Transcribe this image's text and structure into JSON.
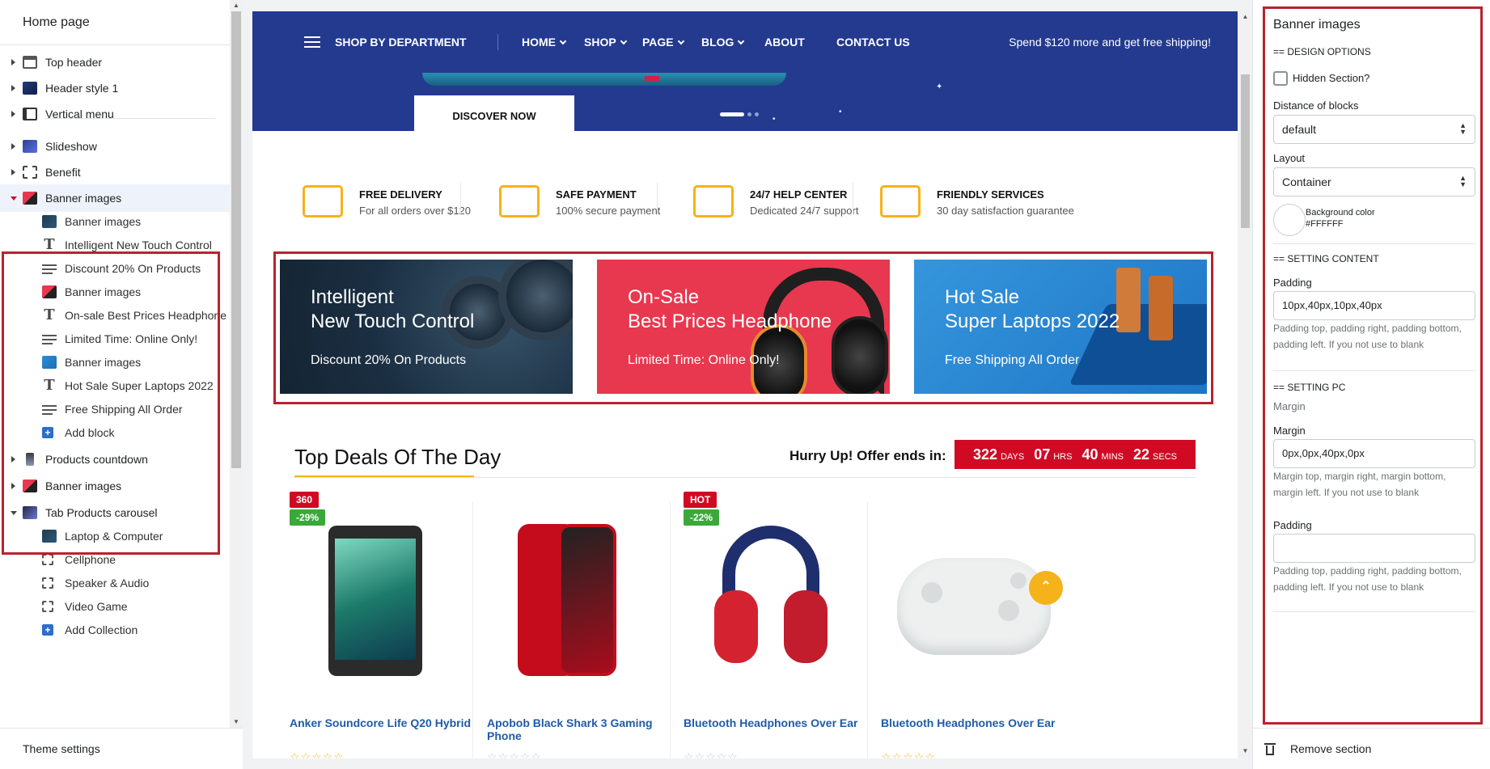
{
  "left": {
    "title": "Home page",
    "items": [
      {
        "label": "Top header"
      },
      {
        "label": "Header style 1"
      },
      {
        "label": "Vertical menu"
      },
      {
        "label": "Slideshow"
      },
      {
        "label": "Benefit"
      },
      {
        "label": "Banner images"
      },
      {
        "label": "Products countdown"
      },
      {
        "label": "Banner images"
      },
      {
        "label": "Tab Products carousel"
      }
    ],
    "banner_children": [
      {
        "label": "Banner images"
      },
      {
        "label": "Intelligent New Touch Control"
      },
      {
        "label": "Discount 20% On Products"
      },
      {
        "label": "Banner images"
      },
      {
        "label": "On-sale Best Prices Headphone"
      },
      {
        "label": "Limited Time: Online Only!"
      },
      {
        "label": "Banner images"
      },
      {
        "label": "Hot Sale Super Laptops 2022"
      },
      {
        "label": "Free Shipping All Order"
      }
    ],
    "add_block": "Add block",
    "tab_children": [
      {
        "label": "Laptop & Computer"
      },
      {
        "label": "Cellphone"
      },
      {
        "label": "Speaker & Audio"
      },
      {
        "label": "Video Game"
      }
    ],
    "add_collection": "Add Collection",
    "theme_settings": "Theme settings"
  },
  "store": {
    "nav": {
      "department": "SHOP BY DEPARTMENT",
      "links": [
        "HOME",
        "SHOP",
        "PAGE",
        "BLOG",
        "ABOUT",
        "CONTACT US"
      ],
      "promo": "Spend $120 more and get free shipping!"
    },
    "discover": "DISCOVER NOW",
    "benefits": [
      {
        "title": "FREE DELIVERY",
        "sub": "For all orders over $120",
        "icon": "truck-icon"
      },
      {
        "title": "SAFE PAYMENT",
        "sub": "100% secure payment",
        "icon": "credit-card-icon"
      },
      {
        "title": "24/7 HELP CENTER",
        "sub": "Dedicated 24/7 support",
        "icon": "chat-icon"
      },
      {
        "title": "FRIENDLY SERVICES",
        "sub": "30 day satisfaction guarantee",
        "icon": "id-card-icon"
      }
    ],
    "banners": [
      {
        "line1": "Intelligent",
        "line2": "New Touch Control",
        "sub": "Discount 20% On Products"
      },
      {
        "line1": "On-Sale",
        "line2": "Best Prices Headphone",
        "sub": "Limited Time: Online Only!"
      },
      {
        "line1": "Hot Sale",
        "line2": "Super Laptops 2022",
        "sub": "Free Shipping All Order"
      }
    ],
    "deals": {
      "title": "Top Deals Of The Day",
      "hurry": "Hurry Up! Offer ends in:",
      "countdown": {
        "days": "322",
        "days_l": "DAYS",
        "hrs": "07",
        "hrs_l": "HRS",
        "mins": "40",
        "mins_l": "MINS",
        "secs": "22",
        "secs_l": "SECS"
      }
    },
    "products": [
      {
        "name": "Anker Soundcore Life Q20 Hybrid",
        "badge1": "360",
        "badge2": "-29%",
        "stars": "☆☆☆☆☆"
      },
      {
        "name": "Apobob Black Shark 3 Gaming Phone",
        "stars": "☆☆☆☆☆"
      },
      {
        "name": "Bluetooth Headphones Over Ear",
        "badge1": "HOT",
        "badge2": "-22%",
        "stars": "☆☆☆☆☆"
      },
      {
        "name": "Bluetooth Headphones Over Ear",
        "stars": "☆☆☆☆☆"
      }
    ]
  },
  "right": {
    "title": "Banner images",
    "design_options": "== DESIGN OPTIONS",
    "hidden_section": "Hidden Section?",
    "distance_label": "Distance of blocks",
    "distance_value": "default",
    "layout_label": "Layout",
    "layout_value": "Container",
    "bg_label": "Background color",
    "bg_value": "#FFFFFF",
    "setting_content": "== SETTING CONTENT",
    "padding_label": "Padding",
    "padding_value": "10px,40px,10px,40px",
    "padding_help": "Padding top, padding right, padding bottom, padding left. If you not use to blank",
    "setting_pc": "== SETTING PC",
    "margin_muted": "Margin",
    "margin_label": "Margin",
    "margin_value": "0px,0px,40px,0px",
    "margin_help": "Margin top, margin right, margin bottom, margin left. If you not use to blank",
    "padding2_label": "Padding",
    "padding2_value": "",
    "padding2_help": "Padding top, padding right, padding bottom, padding left. If you not use to blank",
    "remove": "Remove section"
  },
  "colors": {
    "accent": "#b8232f",
    "nav": "#233a8f",
    "countdown": "#d10a24",
    "star": "#f6b21a",
    "link": "#2c6ecb"
  }
}
